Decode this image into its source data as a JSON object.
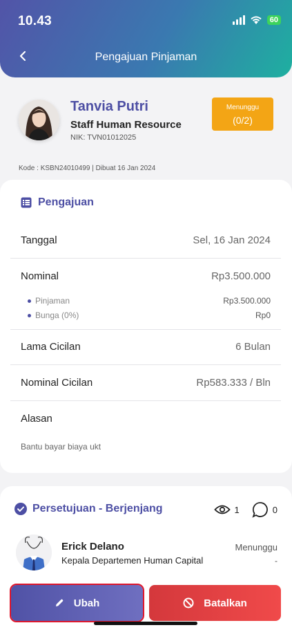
{
  "status_bar": {
    "time": "10.43",
    "battery": "60"
  },
  "header": {
    "title": "Pengajuan Pinjaman"
  },
  "profile": {
    "name": "Tanvia Putri",
    "role": "Staff Human Resource",
    "nik": "NIK: TVN01012025",
    "status_label": "Menunggu",
    "status_count": "(0/2)",
    "code_line": "Kode : KSBN24010499 | Dibuat 16 Jan 2024"
  },
  "pengajuan": {
    "title": "Pengajuan",
    "tanggal_label": "Tanggal",
    "tanggal_value": "Sel, 16 Jan 2024",
    "nominal_label": "Nominal",
    "nominal_value": "Rp3.500.000",
    "pinjaman_label": "Pinjaman",
    "pinjaman_value": "Rp3.500.000",
    "bunga_label": "Bunga (0%)",
    "bunga_value": "Rp0",
    "lama_label": "Lama Cicilan",
    "lama_value": "6 Bulan",
    "nominal_cicilan_label": "Nominal Cicilan",
    "nominal_cicilan_value": "Rp583.333 / Bln",
    "alasan_label": "Alasan",
    "alasan_value": "Bantu bayar biaya ukt"
  },
  "approval": {
    "title": "Persetujuan - Berjenjang",
    "view_count": "1",
    "comment_count": "0",
    "approver_name": "Erick Delano",
    "approver_role": "Kepala Departemen Human Capital",
    "approver_status": "Menunggu",
    "approver_note": "-"
  },
  "actions": {
    "edit_label": "Ubah",
    "cancel_label": "Batalkan"
  },
  "colors": {
    "primary": "#4d4fa4",
    "warning": "#f3a515",
    "danger": "#e0403f"
  }
}
